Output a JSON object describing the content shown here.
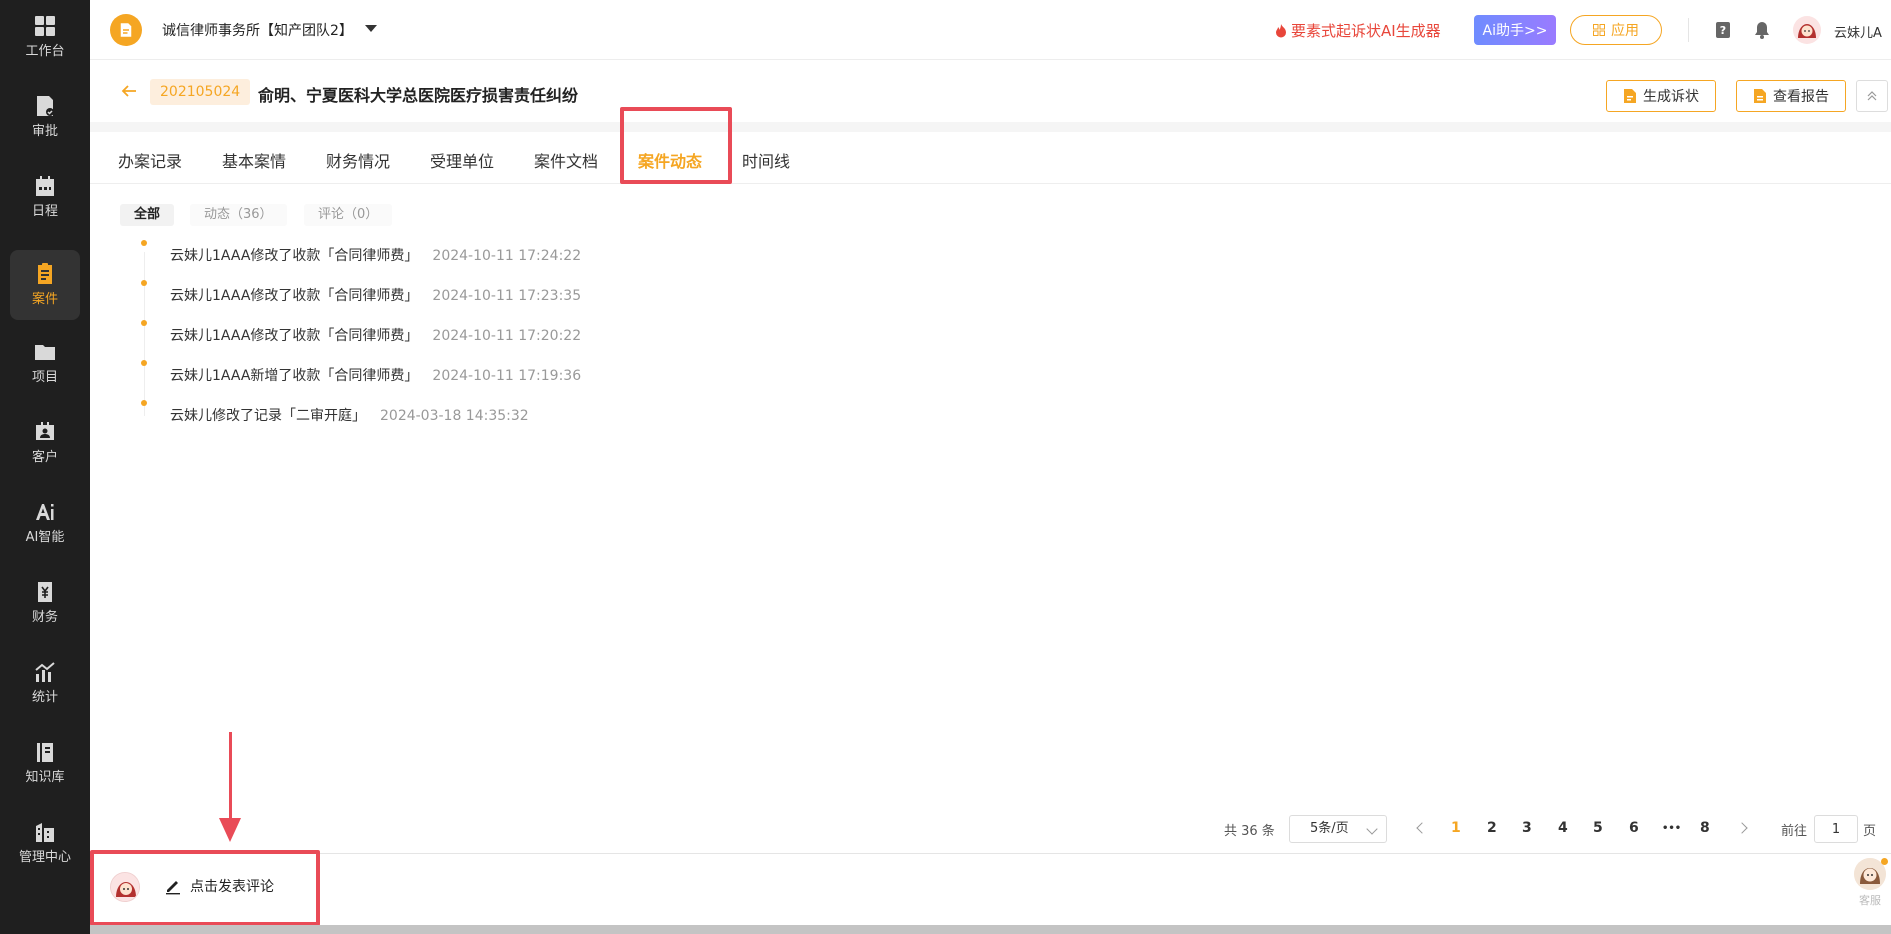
{
  "sidebar": {
    "items": [
      {
        "label": "工作台",
        "icon": "dashboard-icon",
        "active": false
      },
      {
        "label": "审批",
        "icon": "approval-icon",
        "active": false
      },
      {
        "label": "日程",
        "icon": "calendar-icon",
        "active": false
      },
      {
        "label": "案件",
        "icon": "case-icon",
        "active": true
      },
      {
        "label": "项目",
        "icon": "folder-icon",
        "active": false
      },
      {
        "label": "客户",
        "icon": "client-icon",
        "active": false
      },
      {
        "label": "AI智能",
        "icon": "ai-icon",
        "active": false
      },
      {
        "label": "财务",
        "icon": "finance-icon",
        "active": false
      },
      {
        "label": "统计",
        "icon": "stats-icon",
        "active": false
      },
      {
        "label": "知识库",
        "icon": "knowledge-icon",
        "active": false
      },
      {
        "label": "管理中心",
        "icon": "building-icon",
        "active": false
      }
    ]
  },
  "header": {
    "firm_name": "诚信律师事务所【知产团队2】",
    "promo_text": "要素式起诉状AI生成器",
    "ai_button": "Ai助手>>",
    "apps_button": "应用",
    "username": "云妹儿A"
  },
  "case": {
    "number": "202105024",
    "title": "俞明、宁夏医科大学总医院医疗损害责任纠纷",
    "actions": {
      "generate_complaint": "生成诉状",
      "view_report": "查看报告"
    }
  },
  "tabs": [
    {
      "label": "办案记录",
      "active": false
    },
    {
      "label": "基本案情",
      "active": false
    },
    {
      "label": "财务情况",
      "active": false
    },
    {
      "label": "受理单位",
      "active": false
    },
    {
      "label": "案件文档",
      "active": false
    },
    {
      "label": "案件动态",
      "active": true
    },
    {
      "label": "时间线",
      "active": false
    }
  ],
  "filters": [
    {
      "label": "全部",
      "active": true
    },
    {
      "label": "动态（36）",
      "active": false
    },
    {
      "label": "评论（0）",
      "active": false
    }
  ],
  "activities": [
    {
      "text": "云妹儿1AAA修改了收款「合同律师费」",
      "time": "2024-10-11 17:24:22"
    },
    {
      "text": "云妹儿1AAA修改了收款「合同律师费」",
      "time": "2024-10-11 17:23:35"
    },
    {
      "text": "云妹儿1AAA修改了收款「合同律师费」",
      "time": "2024-10-11 17:20:22"
    },
    {
      "text": "云妹儿1AAA新增了收款「合同律师费」",
      "time": "2024-10-11 17:19:36"
    },
    {
      "text": "云妹儿修改了记录「二审开庭」",
      "time": "2024-03-18 14:35:32"
    }
  ],
  "pagination": {
    "total": "共 36 条",
    "page_size": "5条/页",
    "pages": [
      "1",
      "2",
      "3",
      "4",
      "5",
      "6",
      "•••",
      "8"
    ],
    "current": "1",
    "goto_label": "前往",
    "goto_value": "1",
    "goto_suffix": "页"
  },
  "comment": {
    "button": "点击发表评论"
  },
  "support": {
    "label": "客服"
  },
  "colors": {
    "accent": "#f5a623",
    "annotation": "#e94b57",
    "sidebar_bg": "#1f1f1f"
  }
}
